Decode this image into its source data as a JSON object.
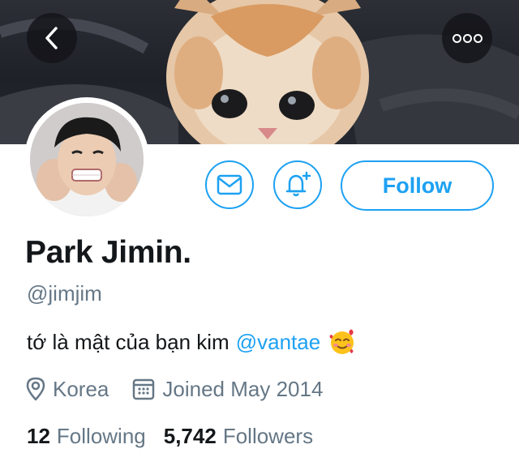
{
  "header": {
    "back_icon": "chevron-left-icon",
    "more_icon": "more-horizontal-icon"
  },
  "actions": {
    "message_icon": "envelope-icon",
    "notify_icon": "bell-plus-icon",
    "follow_label": "Follow"
  },
  "profile": {
    "name": "Park Jimin.",
    "handle": "@jimjim",
    "bio_text": "tớ là mật của bạn kim",
    "bio_mention": "@vantae",
    "bio_emoji": "smiling-face-with-hearts",
    "location": "Korea",
    "joined": "Joined May 2014"
  },
  "stats": {
    "following_count": "12",
    "following_label": "Following",
    "followers_count": "5,742",
    "followers_label": "Followers"
  },
  "colors": {
    "accent": "#1da1f2",
    "secondary_text": "#657786",
    "primary_text": "#14171a"
  }
}
